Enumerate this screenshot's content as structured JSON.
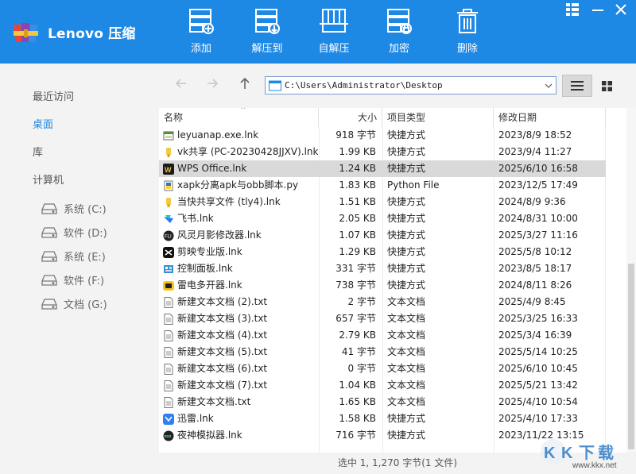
{
  "app": {
    "title": "Lenovo 压缩",
    "brand_color": "#1e88e5"
  },
  "toolbar": {
    "add_label": "添加",
    "extract_to_label": "解压到",
    "self_extract_label": "自解压",
    "encrypt_label": "加密",
    "delete_label": "删除"
  },
  "sidebar": {
    "nav": [
      "最近访问",
      "桌面",
      "库",
      "计算机"
    ],
    "active": "桌面",
    "drives": [
      "系统 (C:)",
      "软件 (D:)",
      "系统 (E:)",
      "软件 (F:)",
      "文档 (G:)"
    ]
  },
  "address": {
    "path": "C:\\Users\\Administrator\\Desktop"
  },
  "columns": {
    "name": "名称",
    "size": "大小",
    "type": "项目类型",
    "date": "修改日期"
  },
  "files": [
    {
      "name": "leyuanap.exe.lnk",
      "size": "918 字节",
      "type": "快捷方式",
      "date": "2023/8/9 18:52",
      "icon": "exe-shortcut-icon"
    },
    {
      "name": "vk共享 (PC-20230428JJXV).lnk",
      "size": "1.99 KB",
      "type": "快捷方式",
      "date": "2023/9/4 11:27",
      "icon": "folder-shortcut-icon"
    },
    {
      "name": "WPS Office.lnk",
      "size": "1.24 KB",
      "type": "快捷方式",
      "date": "2025/6/10 16:58",
      "icon": "wps-icon",
      "selected": true
    },
    {
      "name": "xapk分离apk与obb脚本.py",
      "size": "1.83 KB",
      "type": "Python File",
      "date": "2023/12/5 17:49",
      "icon": "python-file-icon"
    },
    {
      "name": "当快共享文件 (tly4).lnk",
      "size": "1.51 KB",
      "type": "快捷方式",
      "date": "2024/8/9 9:36",
      "icon": "folder-shortcut-icon"
    },
    {
      "name": "飞书.lnk",
      "size": "2.05 KB",
      "type": "快捷方式",
      "date": "2024/8/31 10:00",
      "icon": "feishu-icon"
    },
    {
      "name": "风灵月影修改器.lnk",
      "size": "1.07 KB",
      "type": "快捷方式",
      "date": "2025/3/27 11:16",
      "icon": "trainer-icon"
    },
    {
      "name": "剪映专业版.lnk",
      "size": "1.29 KB",
      "type": "快捷方式",
      "date": "2025/5/8 10:12",
      "icon": "capcut-icon"
    },
    {
      "name": "控制面板.lnk",
      "size": "331 字节",
      "type": "快捷方式",
      "date": "2023/8/5 18:17",
      "icon": "control-panel-icon"
    },
    {
      "name": "雷电多开器.lnk",
      "size": "738 字节",
      "type": "快捷方式",
      "date": "2024/8/11 8:26",
      "icon": "ldplayer-icon"
    },
    {
      "name": "新建文本文档 (2).txt",
      "size": "2 字节",
      "type": "文本文档",
      "date": "2025/4/9 8:45",
      "icon": "text-file-icon"
    },
    {
      "name": "新建文本文档 (3).txt",
      "size": "657 字节",
      "type": "文本文档",
      "date": "2025/3/25 16:33",
      "icon": "text-file-icon"
    },
    {
      "name": "新建文本文档 (4).txt",
      "size": "2.79 KB",
      "type": "文本文档",
      "date": "2025/3/4 16:39",
      "icon": "text-file-icon"
    },
    {
      "name": "新建文本文档 (5).txt",
      "size": "41 字节",
      "type": "文本文档",
      "date": "2025/5/14 10:25",
      "icon": "text-file-icon"
    },
    {
      "name": "新建文本文档 (6).txt",
      "size": "0 字节",
      "type": "文本文档",
      "date": "2025/6/10 10:45",
      "icon": "text-file-icon"
    },
    {
      "name": "新建文本文档 (7).txt",
      "size": "1.04 KB",
      "type": "文本文档",
      "date": "2025/5/21 13:42",
      "icon": "text-file-icon"
    },
    {
      "name": "新建文本文档.txt",
      "size": "1.65 KB",
      "type": "文本文档",
      "date": "2025/4/10 10:54",
      "icon": "text-file-icon"
    },
    {
      "name": "迅雷.lnk",
      "size": "1.58 KB",
      "type": "快捷方式",
      "date": "2025/4/10 17:33",
      "icon": "xunlei-icon"
    },
    {
      "name": "夜神模拟器.lnk",
      "size": "716 字节",
      "type": "快捷方式",
      "date": "2023/11/22 13:15",
      "icon": "nox-icon"
    }
  ],
  "status": {
    "text": "选中 1, 1,270 字节(1 文件)"
  },
  "watermark": {
    "text": "KK下载",
    "url": "www.kkx.net"
  }
}
